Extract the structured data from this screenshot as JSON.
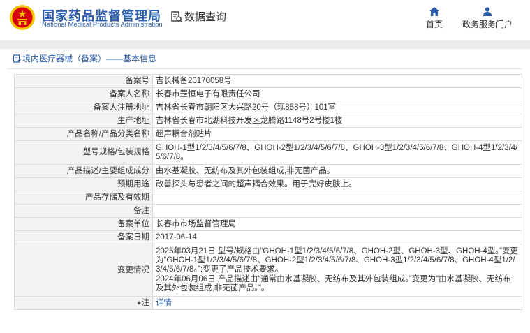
{
  "header": {
    "brand_cn": "国家药品监督管理局",
    "brand_en": "National Medical Products Administration",
    "query_label": "数据查询",
    "nav": [
      {
        "label": "首页",
        "icon": "home-icon"
      },
      {
        "label": "政务服务门户",
        "icon": "user-icon"
      }
    ]
  },
  "colors": {
    "brand": "#2a5caa",
    "logo_red": "#d7000f",
    "logo_gold": "#f5c400"
  },
  "panel": {
    "title": "境内医疗器械（备案）——基本信息"
  },
  "rows": [
    {
      "label": "备案号",
      "value": "吉长械备20170058号"
    },
    {
      "label": "备案人名称",
      "value": "长春市罡恒电子有限责任公司"
    },
    {
      "label": "备案人注册地址",
      "value": "吉林省长春市朝阳区大兴路20号（现858号）101室"
    },
    {
      "label": "生产地址",
      "value": "吉林省长春市北湖科技开发区龙腾路1148号2号楼1楼"
    },
    {
      "label": "产品名称/产品分类名称",
      "value": "超声耦合剂贴片"
    },
    {
      "label": "型号规格/包装规格",
      "value": "GHOH-1型1/2/3/4/5/6/7/8、GHOH-2型1/2/3/4/5/6/7/8、GHOH-3型1/2/3/4/5/6/7/8、GHOH-4型1/2/3/4/5/6/7/8。"
    },
    {
      "label": "产品描述/主要组成成分",
      "value": "由水基凝胶、无纺布及其外包装组成,非无菌产品。"
    },
    {
      "label": "预期用途",
      "value": "改善探头与患者之间的超声耦合效果。用于完好皮肤上。"
    },
    {
      "label": "产品存储及有效期",
      "value": ""
    },
    {
      "label": "备注",
      "value": ""
    },
    {
      "label": "备案单位",
      "value": "长春市市场监督管理局"
    },
    {
      "label": "备案日期",
      "value": "2017-06-14"
    },
    {
      "label": "变更情况",
      "value": "2025年03月21日 型号/规格由“GHOH-1型1/2/3/4/5/6/7/8、GHOH-2型、GHOH-3型、GHOH-4型。”变更为“GHOH-1型1/2/3/4/5/6/7/8、GHOH-2型1/2/3/4/5/6/7/8、GHOH-3型1/2/3/4/5/6/7/8、GHOH-4型1/2/3/4/5/6/7/8。”;变更了产品技术要求。\n2024年06月06日 产品描述由“通常由水基凝胶、无纺布及其外包装组成。”变更为“由水基凝胶、无纺布及其外包装组成,非无菌产品。”。"
    },
    {
      "label": "注",
      "icon": "pin-icon",
      "value": "详情"
    }
  ]
}
